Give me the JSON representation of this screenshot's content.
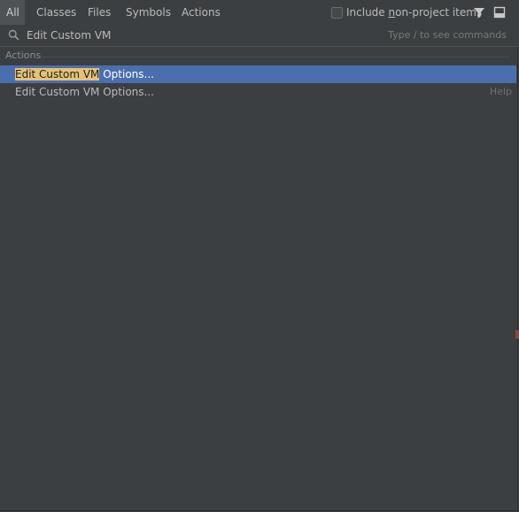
{
  "tabs": [
    {
      "label": "All",
      "active": true
    },
    {
      "label": "Classes",
      "active": false
    },
    {
      "label": "Files",
      "active": false
    },
    {
      "label": "Symbols",
      "active": false
    },
    {
      "label": "Actions",
      "active": false
    }
  ],
  "toolbar": {
    "include_prefix": "Include ",
    "include_underlined": "n",
    "include_rest": "on-project items",
    "include_checked": false,
    "filter_icon": "filter-icon",
    "preview_icon": "preview-panel-icon"
  },
  "search": {
    "value": "Edit Custom VM",
    "hint": "Type / to see commands",
    "icon": "search-icon"
  },
  "group": {
    "title": "Actions"
  },
  "results": [
    {
      "match": "Edit Custom VM",
      "rest": " Options...",
      "right": ""
    },
    {
      "match": "Edit Custom VM",
      "rest": " Options...",
      "right": "Help"
    }
  ],
  "colors": {
    "background": "#3c3f41",
    "selection": "#4b6eaf",
    "match_highlight": "#e5c375"
  }
}
